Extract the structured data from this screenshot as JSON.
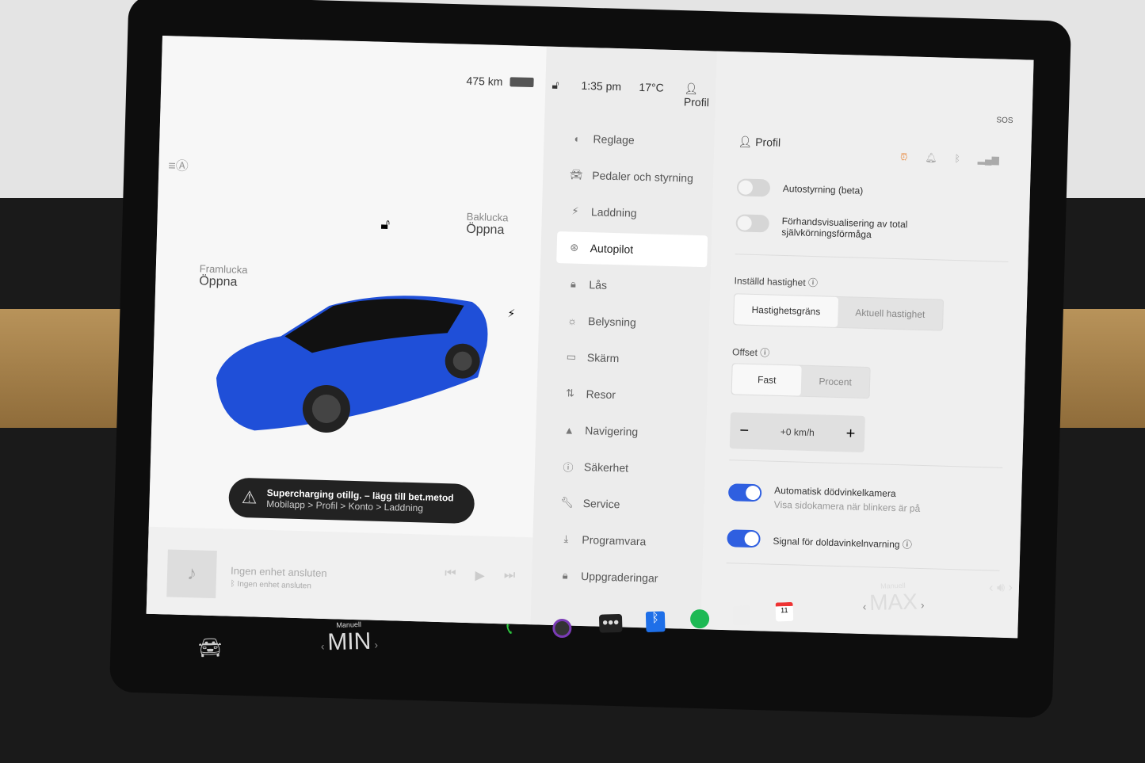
{
  "status": {
    "range": "475 km",
    "time": "1:35 pm",
    "temp": "17°C",
    "profile": "Profil"
  },
  "car": {
    "frunk_label": "Framlucka",
    "frunk_action": "Öppna",
    "trunk_label": "Baklucka",
    "trunk_action": "Öppna",
    "color": "#1f4fd8"
  },
  "alert": {
    "title": "Supercharging otillg. – lägg till bet.metod",
    "subtitle": "Mobilapp > Profil > Konto > Laddning"
  },
  "media": {
    "title": "Ingen enhet ansluten",
    "subtitle": "Ingen enhet ansluten"
  },
  "menu": [
    {
      "label": "Reglage",
      "icon": "toggle-icon"
    },
    {
      "label": "Pedaler och styrning",
      "icon": "car-icon"
    },
    {
      "label": "Laddning",
      "icon": "bolt-icon"
    },
    {
      "label": "Autopilot",
      "icon": "steering-wheel-icon",
      "active": true
    },
    {
      "label": "Lås",
      "icon": "lock-icon"
    },
    {
      "label": "Belysning",
      "icon": "sun-icon"
    },
    {
      "label": "Skärm",
      "icon": "display-icon"
    },
    {
      "label": "Resor",
      "icon": "trips-icon"
    },
    {
      "label": "Navigering",
      "icon": "navigation-icon"
    },
    {
      "label": "Säkerhet",
      "icon": "alert-icon"
    },
    {
      "label": "Service",
      "icon": "wrench-icon"
    },
    {
      "label": "Programvara",
      "icon": "download-icon"
    },
    {
      "label": "Uppgraderingar",
      "icon": "bag-icon"
    }
  ],
  "settings": {
    "profile": "Profil",
    "autosteer": {
      "label": "Autostyrning (beta)",
      "on": false
    },
    "fsd_preview": {
      "label": "Förhandsvisualisering av total självkörningsförmåga",
      "on": false
    },
    "set_speed_label": "Inställd hastighet",
    "set_speed_options": [
      "Hastighetsgräns",
      "Aktuell hastighet"
    ],
    "offset_label": "Offset",
    "offset_options": [
      "Fast",
      "Procent"
    ],
    "offset_value": "+0 km/h",
    "blindspot_cam": {
      "label": "Automatisk dödvinkelkamera",
      "sub": "Visa sidokamera när blinkers är på",
      "on": true
    },
    "blindspot_chime": {
      "label": "Signal för doldavinkelnvarning",
      "on": true
    }
  },
  "climate": {
    "left_mode": "Manuell",
    "left_value": "MIN",
    "right_mode": "Manuell",
    "right_value": "MAX"
  },
  "sos": "SOS"
}
